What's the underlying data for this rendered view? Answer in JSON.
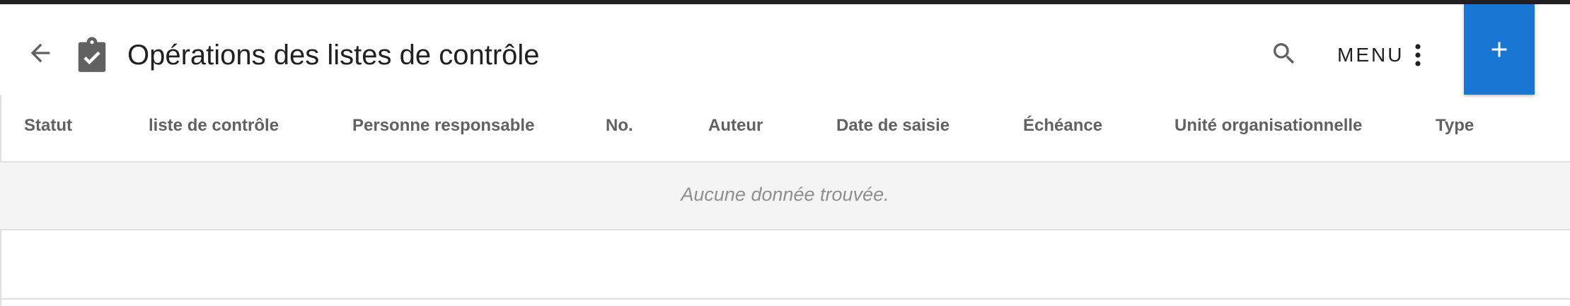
{
  "header": {
    "title": "Opérations des listes de contrôle",
    "menu_label": "MENU",
    "icons": {
      "back": "arrow-left-icon",
      "clipboard": "clipboard-check-icon",
      "search": "search-icon",
      "more": "more-vertical-icon",
      "add": "plus-icon"
    }
  },
  "table": {
    "columns": [
      "Statut",
      "liste de contrôle",
      "Personne responsable",
      "No.",
      "Auteur",
      "Date de saisie",
      "Échéance",
      "Unité organisationnelle",
      "Type"
    ],
    "empty_message": "Aucune donnée trouvée."
  },
  "colors": {
    "accent": "#1976d2",
    "top_strip": "#212121",
    "empty_row_bg": "#f4f4f4"
  }
}
